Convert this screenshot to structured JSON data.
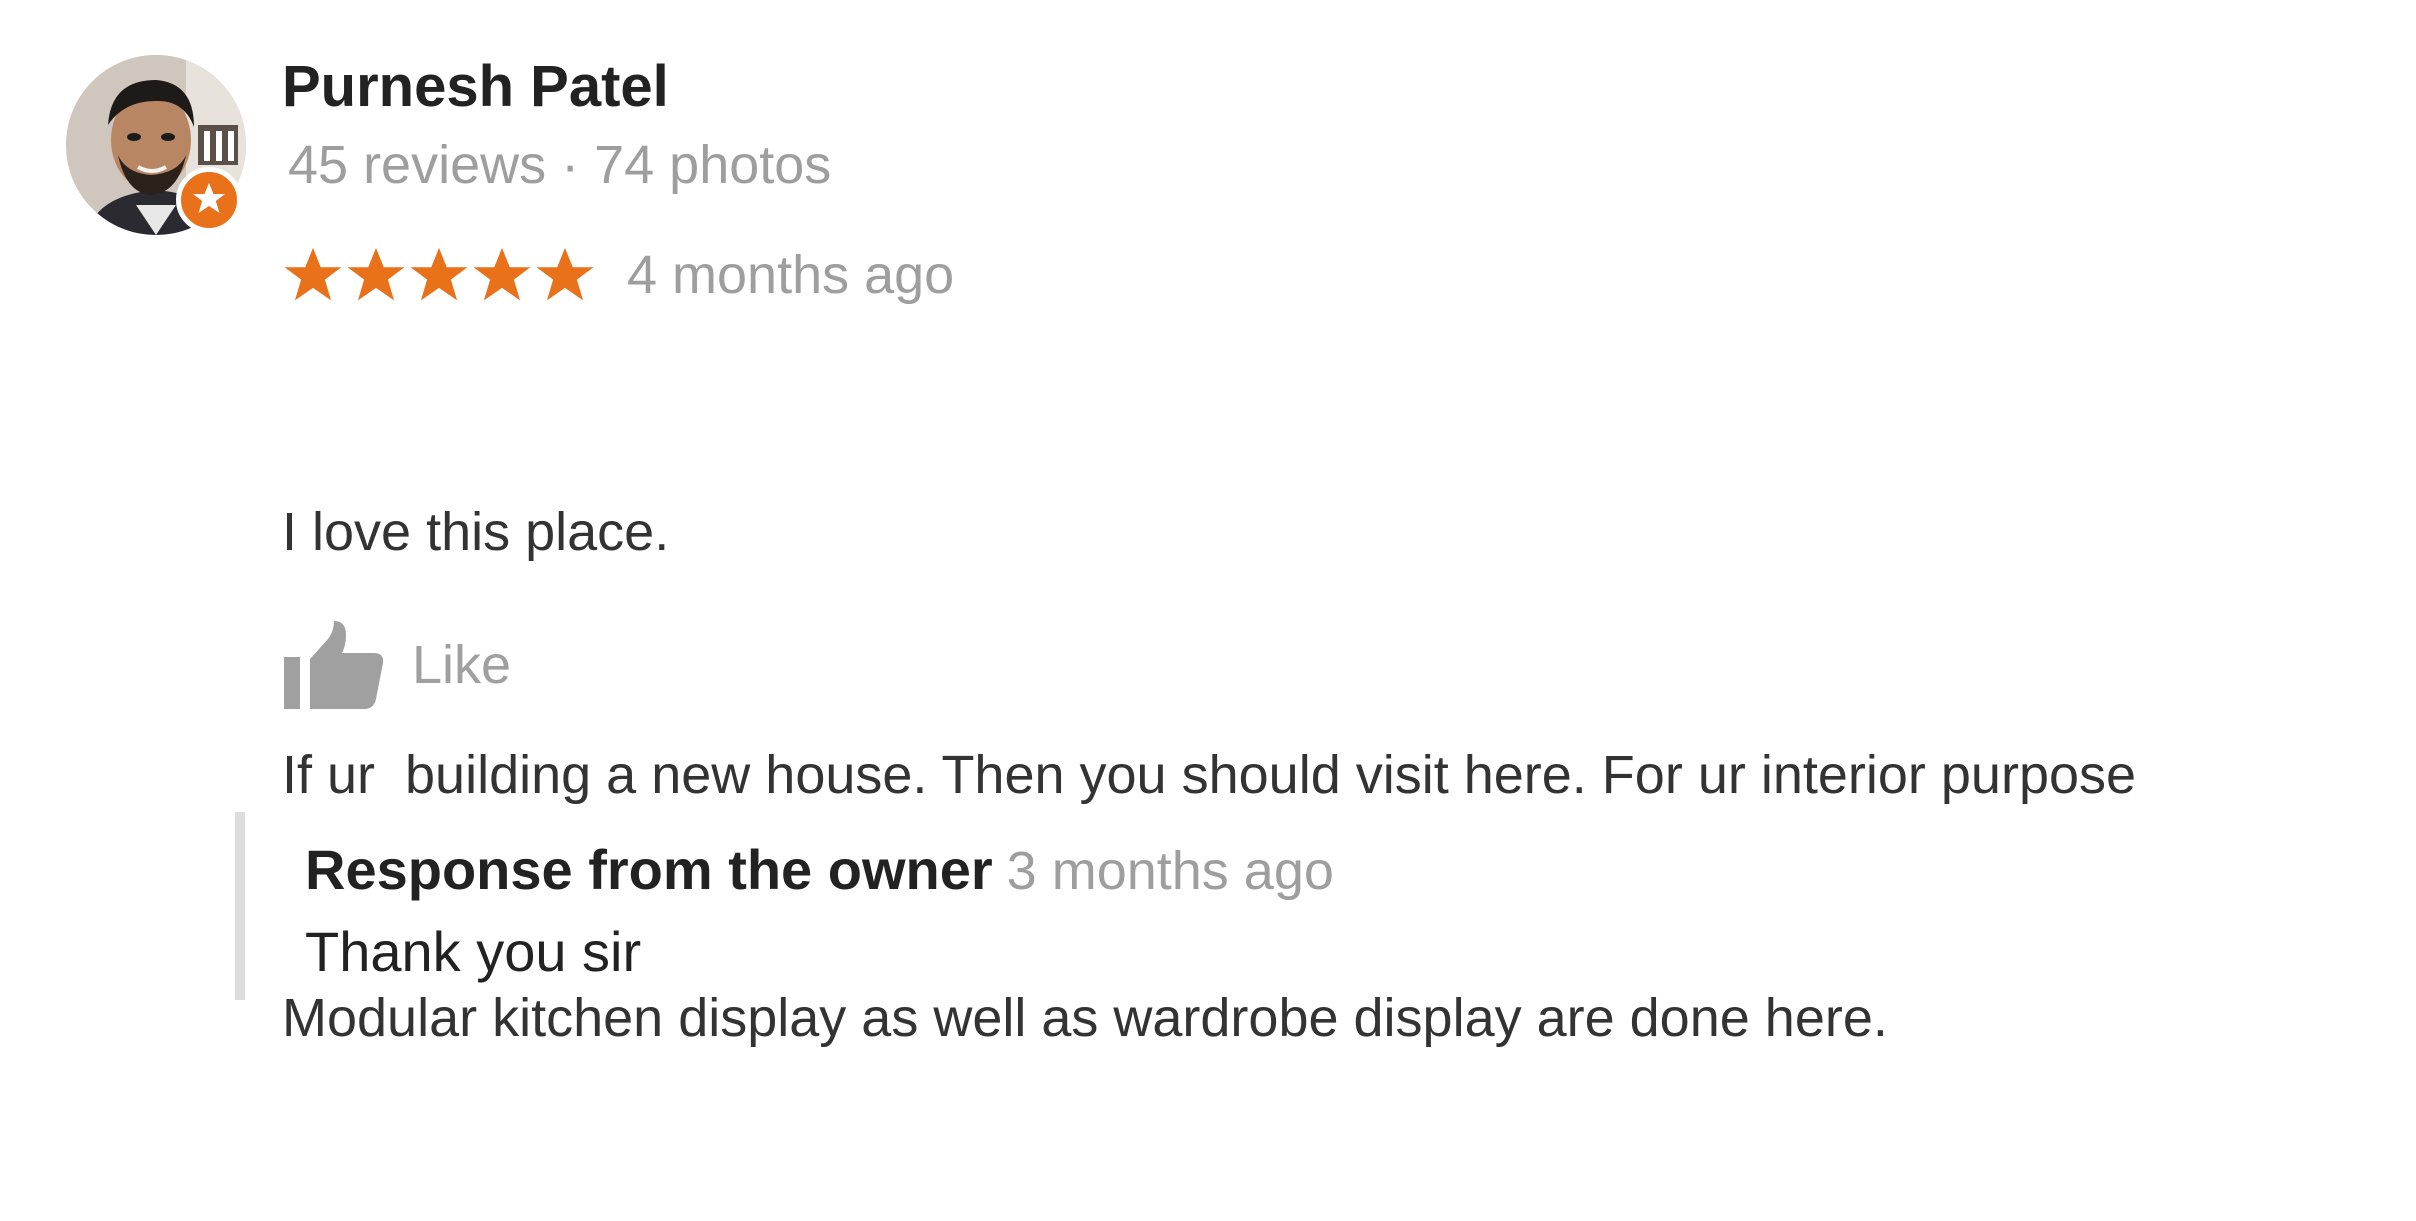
{
  "review": {
    "author": {
      "name": "Purnesh Patel",
      "meta": "45 reviews · 74 photos",
      "avatar_icon": "person-avatar",
      "badge_icon": "local-guide-badge-icon"
    },
    "rating": {
      "stars": 5,
      "max_stars": 5,
      "star_color": "#e8711a"
    },
    "date": "4 months ago",
    "text_lines": [
      "I love this place.",
      "If ur  building a new house. Then you should visit here. For ur interior purpose",
      "Modular kitchen display as well as wardrobe display are done here."
    ],
    "like": {
      "label": "Like",
      "icon": "thumbs-up-icon"
    },
    "owner_response": {
      "title": "Response from the owner",
      "date": "3 months ago",
      "text": "Thank you sir"
    }
  },
  "colors": {
    "accent": "#e8711a",
    "muted_text": "#9e9e9e",
    "primary_text": "#222222",
    "response_border": "#dddddd"
  }
}
